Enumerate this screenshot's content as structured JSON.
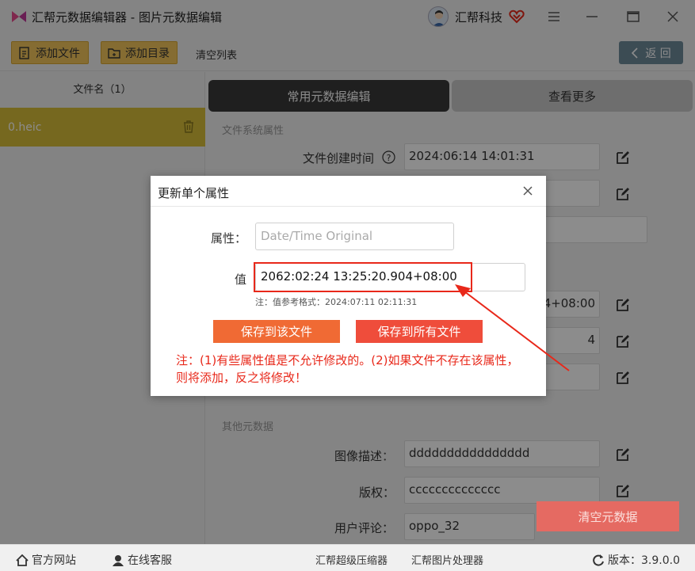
{
  "window": {
    "title": "汇帮元数据编辑器 - 图片元数据编辑",
    "user_name": "汇帮科技"
  },
  "toolbar": {
    "add_file": "添加文件",
    "add_dir": "添加目录",
    "clear_list": "清空列表",
    "back": "返 回"
  },
  "left_panel": {
    "header": "文件名（1）",
    "files": [
      "0.heic"
    ]
  },
  "tabs": {
    "common": "常用元数据编辑",
    "more": "查看更多"
  },
  "sections": {
    "fs": "文件系统属性",
    "other": "其他元数据"
  },
  "fields": {
    "create_time_label": "文件创建时间",
    "create_time_value": "2024:06:14 14:01:31",
    "row4_value_tail": "4+08:00",
    "row5_value_tail": "4",
    "image_desc_label": "图像描述",
    "image_desc_value": "dddddddddddddddd",
    "copyright_label": "版权",
    "copyright_value": "cccccccccccccc",
    "comment_label": "用户评论",
    "comment_value": "oppo_32"
  },
  "clear_meta_btn": "清空元数据",
  "dialog": {
    "title": "更新单个属性",
    "attr_label": "属性：",
    "attr_placeholder": "Date/Time Original",
    "value_label": "值",
    "value": "2062:02:24 13:25:20.904+08:00",
    "note": "注：值参考格式：2024:07:11 02:11:31",
    "save_this": "保存到该文件",
    "save_all": "保存到所有文件",
    "warning": "注：(1)有些属性值是不允许修改的。(2)如果文件不存在该属性，则将添加，反之将修改！"
  },
  "statusbar": {
    "website": "官方网站",
    "service": "在线客服",
    "compressor": "汇帮超级压缩器",
    "image_tool": "汇帮图片处理器",
    "version": "版本：3.9.0.0"
  },
  "colors": {
    "accent_yellow": "#f2c55c",
    "selected_file": "#d8bd39",
    "dialog_orange": "#f06a34",
    "dialog_red": "#ef4d3b",
    "warning_text": "#e8281a"
  }
}
